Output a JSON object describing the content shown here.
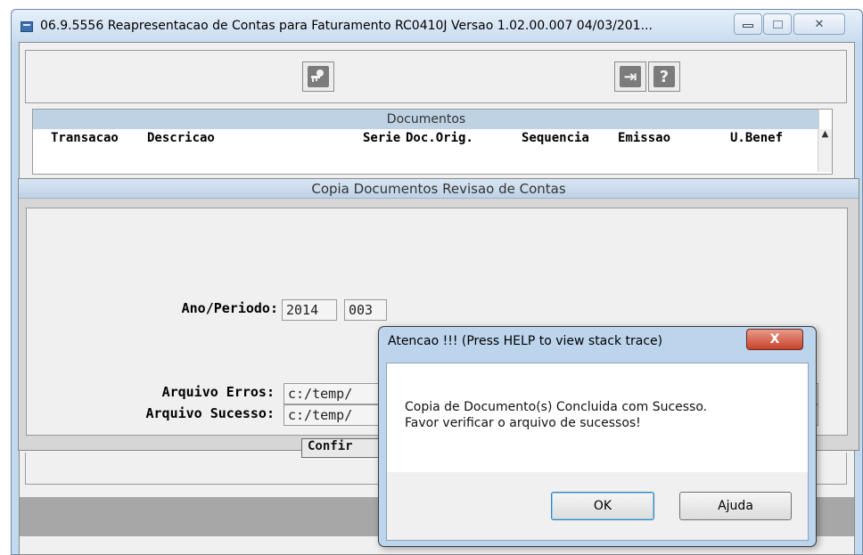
{
  "window": {
    "title": "06.9.5556  Reapresentacao de Contas para Faturamento RC0410J Versao 1.02.00.007 04/03/201...",
    "close_glyph": "✕"
  },
  "toolbar": {
    "left_icon": "key-person-icon",
    "right_icons": [
      "exit-door-icon",
      "help-question-icon"
    ],
    "glyph_exit": "⇥",
    "glyph_help": "?"
  },
  "browse": {
    "title": "Documentos",
    "columns": [
      "Transacao",
      "Descricao",
      "Serie",
      "Doc.Orig.",
      "Sequencia",
      "Emissao",
      "U.Benef"
    ],
    "scroll_up": "▲"
  },
  "copy_dialog": {
    "title": "Copia Documentos Revisao de Contas",
    "ano_periodo_label": "Ano/Periodo:",
    "ano_value": "2014",
    "periodo_value": "003",
    "arquivo_erros_label": "Arquivo Erros:",
    "arquivo_erros_value": "c:/temp/",
    "arquivo_sucesso_label": "Arquivo Sucesso:",
    "arquivo_sucesso_value": "c:/temp/",
    "confirm_label": "Confir"
  },
  "message_box": {
    "title": "Atencao !!! (Press HELP to view stack trace)",
    "close_glyph": "X",
    "line1": "Copia de Documento(s) Concluida com Sucesso.",
    "line2": "Favor verificar o arquivo de sucessos!",
    "ok_label": "OK",
    "help_label": "Ajuda"
  },
  "colors": {
    "window_frame": "#c3d9ee",
    "browse_header": "#bfd2e4",
    "close_button": "#c7432b",
    "status_bar": "#a7a7a7"
  }
}
